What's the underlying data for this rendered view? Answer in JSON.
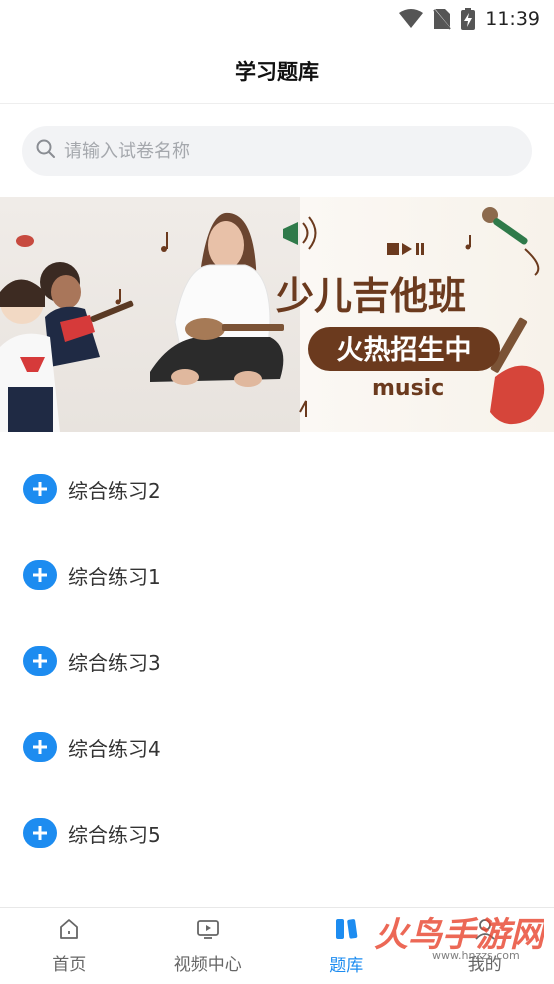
{
  "status": {
    "time": "11:39"
  },
  "header": {
    "title": "学习题库"
  },
  "search": {
    "placeholder": "请输入试卷名称"
  },
  "banner": {
    "title": "少儿吉他班",
    "subtitle": "火热招生中",
    "tag": "music",
    "active_dot": 0,
    "dot_count": 3
  },
  "exercises": [
    {
      "label": "综合练习2"
    },
    {
      "label": "综合练习1"
    },
    {
      "label": "综合练习3"
    },
    {
      "label": "综合练习4"
    },
    {
      "label": "综合练习5"
    }
  ],
  "tabs": [
    {
      "label": "首页",
      "icon": "home-icon",
      "active": false
    },
    {
      "label": "视频中心",
      "icon": "video-icon",
      "active": false
    },
    {
      "label": "题库",
      "icon": "question-bank-icon",
      "active": true
    },
    {
      "label": "我的",
      "icon": "profile-icon",
      "active": false
    }
  ],
  "watermark": {
    "text": "火鸟手游网",
    "url_text": "www.hnzzs.com"
  },
  "colors": {
    "accent": "#1d8cf0",
    "banner_brown": "#6b3a1e",
    "inactive": "#666666"
  }
}
